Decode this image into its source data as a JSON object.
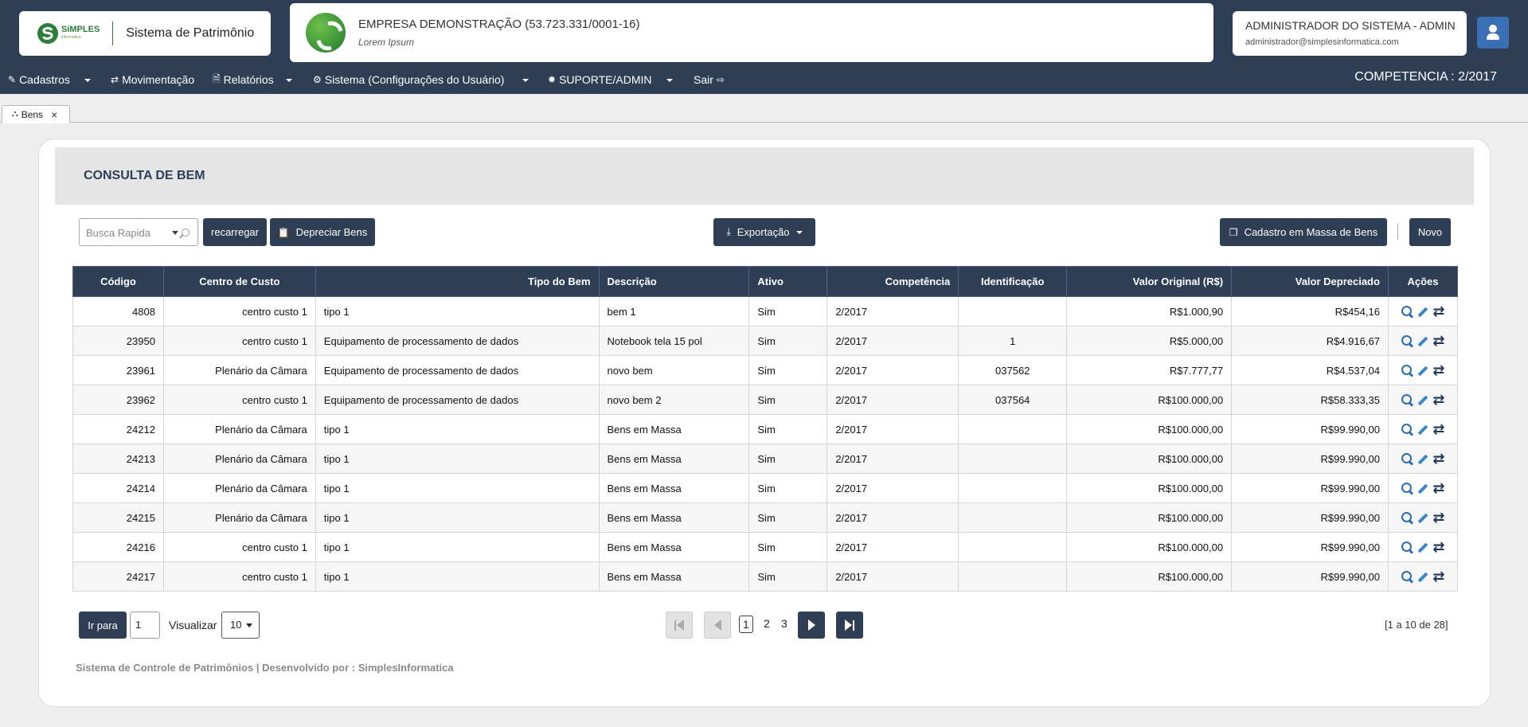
{
  "header": {
    "brand_logo_text": "SiMPLES",
    "brand_logo_sub": "informática",
    "brand_title": "Sistema de Patrimônio",
    "company_name": "EMPRESA DEMONSTRAÇÃO (53.723.331/0001-16)",
    "company_sub": "Lorem Ipsum",
    "user_name": "ADMINISTRADOR DO SISTEMA - ADMIN",
    "user_email": "administrador@simplesinformatica.com",
    "competencia": "COMPETENCIA : 2/2017"
  },
  "nav": {
    "cadastros": "Cadastros",
    "movimentacao": "Movimentação",
    "relatorios": "Relatórios",
    "sistema": "Sistema (Configurações do Usuário)",
    "suporte": "SUPORTE/ADMIN",
    "sair": "Sair"
  },
  "tab": {
    "label": "Bens"
  },
  "page": {
    "title": "CONSULTA DE BEM",
    "search_placeholder": "Busca Rapida",
    "recarregar": "recarregar",
    "depreciar": "Depreciar Bens",
    "exportacao": "Exportação",
    "cadastro_massa": "Cadastro em Massa de Bens",
    "novo": "Novo"
  },
  "table": {
    "headers": [
      "Código",
      "Centro de Custo",
      "Tipo do Bem",
      "Descrição",
      "Ativo",
      "Competência",
      "Identificação",
      "Valor Original (R$)",
      "Valor Depreciado",
      "Ações"
    ],
    "rows": [
      [
        "4808",
        "centro custo 1",
        "tipo 1",
        "bem 1",
        "Sim",
        "2/2017",
        "",
        "R$1.000,90",
        "R$454,16"
      ],
      [
        "23950",
        "centro custo 1",
        "Equipamento de processamento de dados",
        "Notebook tela 15 pol",
        "Sim",
        "2/2017",
        "1",
        "R$5.000,00",
        "R$4.916,67"
      ],
      [
        "23961",
        "Plenário da Câmara",
        "Equipamento de processamento de dados",
        "novo bem",
        "Sim",
        "2/2017",
        "037562",
        "R$7.777,77",
        "R$4.537,04"
      ],
      [
        "23962",
        "centro custo 1",
        "Equipamento de processamento de dados",
        "novo bem 2",
        "Sim",
        "2/2017",
        "037564",
        "R$100.000,00",
        "R$58.333,35"
      ],
      [
        "24212",
        "Plenário da Câmara",
        "tipo 1",
        "Bens em Massa",
        "Sim",
        "2/2017",
        "",
        "R$100.000,00",
        "R$99.990,00"
      ],
      [
        "24213",
        "Plenário da Câmara",
        "tipo 1",
        "Bens em Massa",
        "Sim",
        "2/2017",
        "",
        "R$100.000,00",
        "R$99.990,00"
      ],
      [
        "24214",
        "Plenário da Câmara",
        "tipo 1",
        "Bens em Massa",
        "Sim",
        "2/2017",
        "",
        "R$100.000,00",
        "R$99.990,00"
      ],
      [
        "24215",
        "Plenário da Câmara",
        "tipo 1",
        "Bens em Massa",
        "Sim",
        "2/2017",
        "",
        "R$100.000,00",
        "R$99.990,00"
      ],
      [
        "24216",
        "centro custo 1",
        "tipo 1",
        "Bens em Massa",
        "Sim",
        "2/2017",
        "",
        "R$100.000,00",
        "R$99.990,00"
      ],
      [
        "24217",
        "centro custo 1",
        "tipo 1",
        "Bens em Massa",
        "Sim",
        "2/2017",
        "",
        "R$100.000,00",
        "R$99.990,00"
      ]
    ]
  },
  "pagination": {
    "goto_label": "Ir para",
    "goto_value": "1",
    "visualizar": "Visualizar",
    "per_page": "10",
    "pages": [
      "1",
      "2",
      "3"
    ],
    "current_page": "1",
    "range": "[1 a 10 de 28]"
  },
  "footer": {
    "text": "Sistema de Controle de Patrimônios | Desenvolvido por : SimplesInformatica"
  },
  "colors": {
    "primary": "#2d3e55",
    "brand_green": "#2f7d3a",
    "user_button": "#3a6fb6"
  }
}
